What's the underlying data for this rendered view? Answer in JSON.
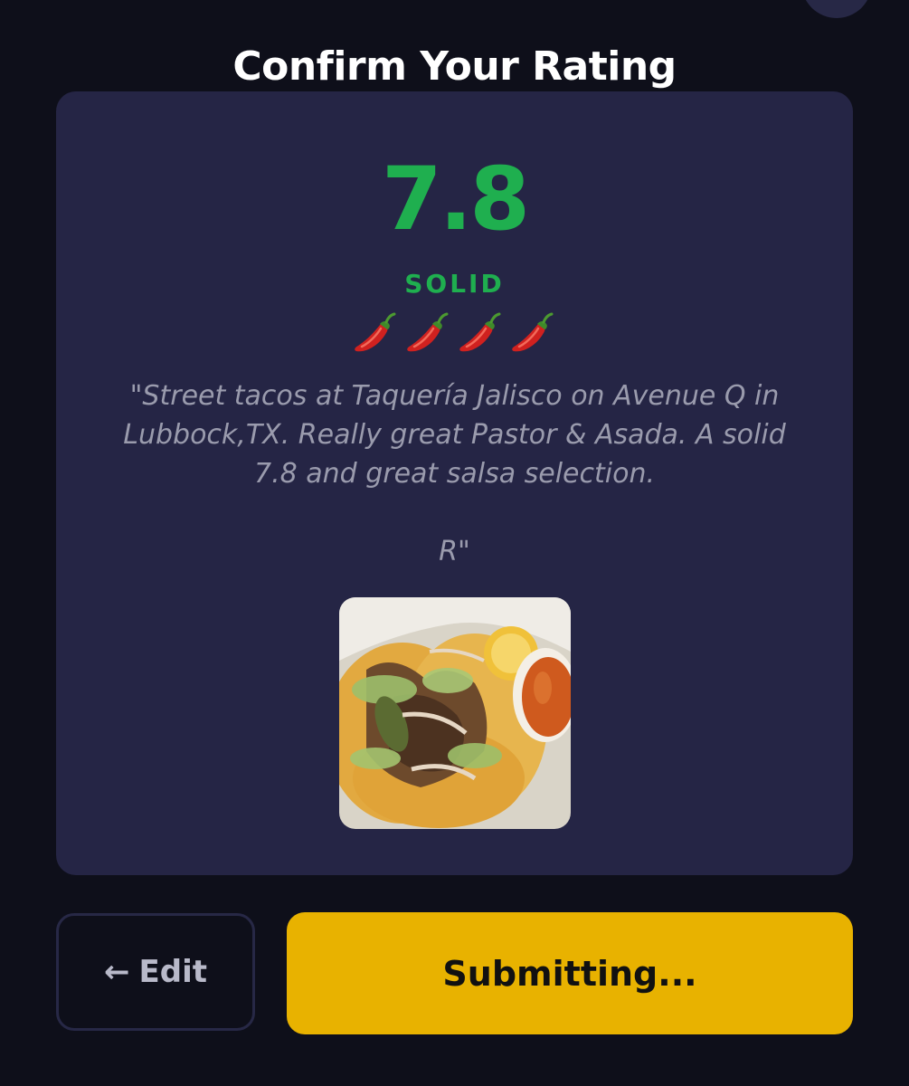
{
  "header": {
    "title": "Confirm Your Rating"
  },
  "rating": {
    "score": "7.8",
    "verdict": "SOLID",
    "pepper_count": 4,
    "pepper_icon": "hot-pepper-icon",
    "quote": "\"Street tacos at Taquería Jalisco on Avenue Q in Lubbock,TX. Really great Pastor & Asada. A solid 7.8 and great salsa selection.\n\nR\""
  },
  "actions": {
    "edit_icon": "arrow-left-icon",
    "edit_arrow": "←",
    "edit_label": "Edit",
    "submit_label": "Submitting..."
  },
  "colors": {
    "background": "#0e0f1a",
    "card": "#252545",
    "score_green": "#1faf4f",
    "submit_yellow": "#e8b200",
    "edit_border": "#272846"
  }
}
